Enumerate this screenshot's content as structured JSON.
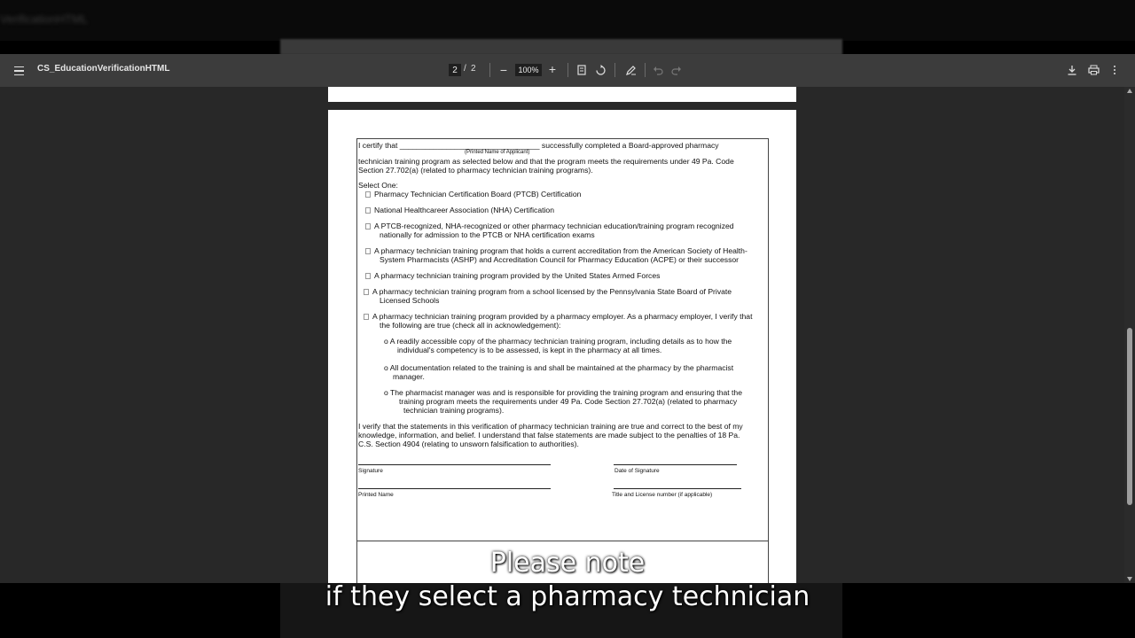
{
  "ghost": {
    "title": "VerificationHTML"
  },
  "toolbar": {
    "title": "CS_EducationVerificationHTML",
    "page_current": "2",
    "page_sep": "/",
    "page_total": "2",
    "zoom": "100%",
    "zoom_out": "−",
    "zoom_in": "+"
  },
  "form": {
    "certify_1": "I certify that _________________________________ successfully completed a Board-approved pharmacy",
    "printed_name_label": "(Printed Name of Applicant)",
    "certify_2": "technician training program as selected below and that the program meets the requirements under 49 Pa. Code",
    "certify_3": "Section 27.702(a) (related to pharmacy technician training programs).",
    "select_one": "Select One:",
    "opt1": "Pharmacy Technician Certification Board (PTCB) Certification",
    "opt2": "National Healthcareer Association (NHA) Certification",
    "opt3a": "A PTCB-recognized, NHA-recognized or other pharmacy technician education/training program recognized",
    "opt3b": "nationally for admission to the PTCB or NHA certification exams",
    "opt4a": "A pharmacy technician training program that holds a current accreditation from the American Society of Health-",
    "opt4b": "System Pharmacists (ASHP) and Accreditation Council for Pharmacy Education (ACPE) or their successor",
    "opt5": "A pharmacy technician training program provided by the United States Armed Forces",
    "opt6a": "A pharmacy technician training program from a school licensed by the Pennsylvania State Board of Private",
    "opt6b": "Licensed Schools",
    "opt7a": "A pharmacy technician training program provided by a pharmacy employer. As a pharmacy employer, I verify that",
    "opt7b": "the following are true (check all in acknowledgement):",
    "sub1a": "o A readily accessible copy of the pharmacy technician training program, including details as to how the",
    "sub1b": "individual's competency is to be assessed, is kept in the pharmacy at all times.",
    "sub2a": "o All documentation related to the training is and shall be maintained at the pharmacy by the pharmacist",
    "sub2b": "manager.",
    "sub3a": "o The pharmacist manager was and is responsible for providing the training program and ensuring that the",
    "sub3b": "training program meets the requirements under 49 Pa. Code Section 27.702(a) (related to pharmacy",
    "sub3c": "technician training programs).",
    "verify_1": "I verify that the statements in this verification of pharmacy technician training are true and correct to the best of my",
    "verify_2": "knowledge, information, and belief. I understand that false statements are made subject to the penalties of 18 Pa.",
    "verify_3": "C.S. Section 4904 (relating to unsworn falsification to authorities).",
    "signature_label": "Signature",
    "date_label": "Date of Signature",
    "printed_label": "Printed Name",
    "title_label": "Title and License number (if applicable)"
  },
  "captions": {
    "line1": "Please note",
    "line2": "if they select a pharmacy technician"
  }
}
